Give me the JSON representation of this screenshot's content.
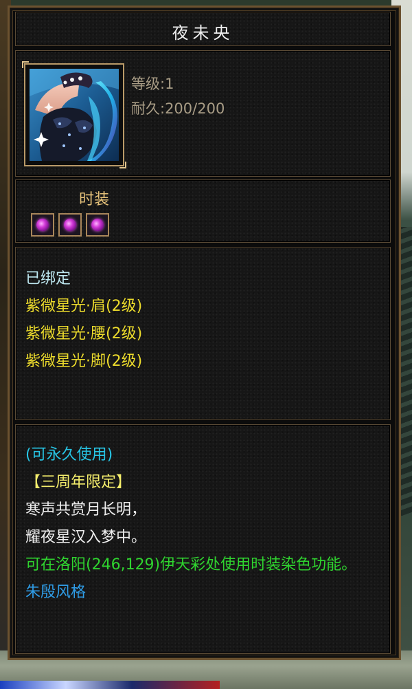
{
  "item": {
    "name": "夜未央",
    "level": "等级:1",
    "durability": "耐久:200/200",
    "type": "时装",
    "gem_slots": 3,
    "gem_color": "#c43ad0"
  },
  "attributes": {
    "bound": "已绑定",
    "set_bonuses": [
      "紫微星光·肩(2级)",
      "紫微星光·腰(2级)",
      "紫微星光·脚(2级)"
    ]
  },
  "description": {
    "permanent": "(可永久使用)",
    "limited": "【三周年限定】",
    "poem": [
      "寒声共赏月长明，",
      "耀夜星汉入梦中。"
    ],
    "usage": "可在洛阳(246,129)伊天彩处使用时装染色功能。",
    "style": "朱殷风格"
  },
  "colors": {
    "frame": "#6b5230",
    "bound_text": "#bfe9f2",
    "set_text": "#eddc2c",
    "permanent_text": "#27c6e6",
    "limited_text": "#f5ee6c",
    "usage_text": "#2fd42f",
    "style_text": "#2f9ce6"
  },
  "icons": {
    "item_icon": "costume-portrait-icon",
    "gem_icon": "purple-gem-icon"
  }
}
